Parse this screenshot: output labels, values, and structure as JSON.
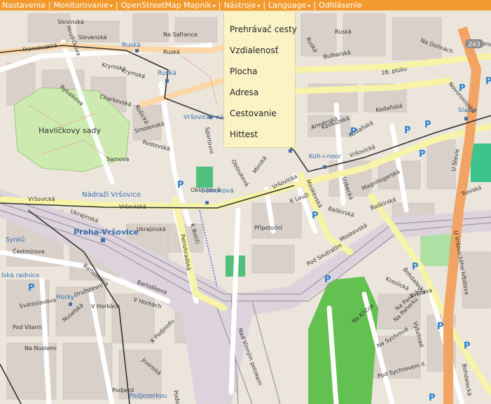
{
  "menu": {
    "items": [
      {
        "label": "Nastavenia",
        "caret": false
      },
      {
        "label": "Monitorovanie",
        "caret": true
      },
      {
        "label": "OpenStreetMap Mapnik",
        "caret": true
      },
      {
        "label": "Nástroje",
        "caret": true
      },
      {
        "label": "Language",
        "caret": true
      },
      {
        "label": "Odhlásenie",
        "caret": false
      }
    ],
    "separator": "|",
    "caret_glyph": "▾",
    "color": "#f39a2e"
  },
  "dropdown": {
    "items": [
      "Prehrávač cesty",
      "Vzdialenosť",
      "Plocha",
      "Adresa",
      "Cestovanie",
      "Hittest"
    ],
    "background": "#fbf3c6"
  },
  "map": {
    "streets": [
      "Francouzská",
      "Ruská",
      "Ruská",
      "Na Safrance",
      "Slovenská",
      "Bulharská",
      "Kodaňská",
      "28. pluku",
      "Krymská",
      "Rybalkova",
      "Charkovská",
      "Košická",
      "Smolenská",
      "Rostovská",
      "Sportovní",
      "Vršovická",
      "Vršovická",
      "Vršovická",
      "Vršovická",
      "Minská",
      "Oblouková",
      "Moskevská",
      "Moskevská",
      "Kavkazská",
      "Uzbecká",
      "Magnitogorská",
      "Baškirská",
      "Baškirská",
      "K Louži",
      "Přípotoční",
      "Petrohradská",
      "Ukrajinská",
      "Ukrajinská",
      "Bartoškova",
      "Bartoškova",
      "Družstevní",
      "V Horkách",
      "V Horkách",
      "Svatoslavova",
      "Nuselská",
      "K Podjezdu",
      "Jivenská",
      "Na Pankráci",
      "Na Sychrově",
      "Pod Sychrovem II",
      "Bohdalecká",
      "Bohdalecká",
      "Kreslická",
      "U Slavie",
      "Tuniská",
      "Arménská",
      "Samova",
      "Ruská",
      "Holandská",
      "Na Dolinách",
      "Pod Soutratím",
      "K Botiči",
      "Podolská",
      "Nad Vinným potokem",
      "Novorossijská",
      "U Vršovického hřbitova",
      "Svatova",
      "Na Kříčce",
      "Na Pahorku",
      "Vyšehrad",
      "Kodaňská",
      "Podjezd",
      "Krymská",
      "Čestmírova",
      "Pod Vilami",
      "Na Nuslemi",
      "Hrudičkova",
      "Oblouková",
      "Slovinská"
    ],
    "places": [
      "Havlíčkovy sady",
      "Praha-Vršovice",
      "Nádraží Vršovice",
      "Ruská",
      "Ruská",
      "Vršovické nám.",
      "Oblouková",
      "Koh-i-noor",
      "Slavia",
      "Horky",
      "Podjezerkou",
      "Synků",
      "lská radnice",
      "243"
    ],
    "parking_glyph": "P"
  }
}
